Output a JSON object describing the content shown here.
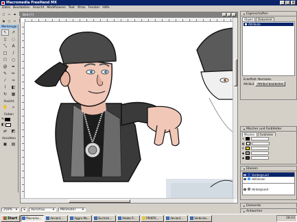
{
  "window": {
    "title": "Macromedia FreeHand MX"
  },
  "menu": [
    "Datei",
    "Bearbeiten",
    "Ansicht",
    "Modifizieren",
    "Text",
    "Xtras",
    "Fenster",
    "Hilfe"
  ],
  "document": {
    "title": "Bild-[?]"
  },
  "tools_panel": {
    "title": "Werkzeuge",
    "sections": {
      "view": "Ansicht",
      "colors": "Farben",
      "options": "Ansichten"
    },
    "colors": {
      "stroke": "#000000",
      "fill": "#ffffff"
    }
  },
  "statusbar": {
    "zoom": "250%",
    "view_mode": "Vorschau",
    "units": "Millimeter"
  },
  "properties_panel": {
    "title": "Eigenschaften",
    "tabs": [
      "Objekt",
      "Dokument"
    ],
    "selected_item": "Attribute",
    "effect_label": "Eckeffekt: Normalen",
    "effect_value": "Attribut",
    "effect_button": "Attribut bearbeiten"
  },
  "mixer_panel": {
    "title": "Mischer und Farbfelder",
    "tabs": [
      "Mischer",
      "Farbfelder"
    ],
    "rows": [
      {
        "color": "#000000"
      },
      {
        "color": "#ffffff"
      },
      {
        "color": "#e8d000"
      },
      {
        "color": "#a0a0a0"
      },
      {
        "color": "#303030"
      }
    ]
  },
  "layers_panel": {
    "title": "Ebenen",
    "layers": [
      {
        "name": "Vordergrund",
        "selected": true,
        "color": "#2050c0"
      },
      {
        "name": "Hilfslinien",
        "selected": false,
        "color": "#40a0ff"
      },
      {
        "name": "Hintergrund",
        "selected": false,
        "color": "#808080"
      }
    ]
  },
  "collapsed_panels": [
    "Elemente",
    "Antworten"
  ],
  "taskbar": {
    "start_label": "Start",
    "tasks": [
      "Macrome...",
      "deviant...",
      "Aggro-Mu...",
      "Buchste...",
      "Adobe P...",
      "PRINTK...",
      "deviant...",
      "Verbindu..."
    ],
    "active_index": 0,
    "clock": "18:23"
  }
}
